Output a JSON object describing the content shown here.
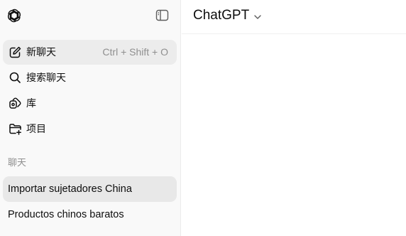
{
  "sidebar": {
    "new_chat": {
      "label": "新聊天",
      "shortcut": "Ctrl + Shift + O"
    },
    "search": {
      "label": "搜索聊天"
    },
    "library": {
      "label": "库"
    },
    "projects": {
      "label": "项目"
    },
    "section_label": "聊天",
    "chats": [
      {
        "title": "Importar sujetadores China",
        "active": true
      },
      {
        "title": "Productos chinos baratos",
        "active": false
      }
    ]
  },
  "header": {
    "model_name": "ChatGPT"
  },
  "icons": {
    "logo": "openai-logo-icon",
    "toggle": "sidebar-toggle-icon",
    "new_chat": "compose-icon",
    "search": "search-icon",
    "library": "library-icon",
    "projects": "folder-plus-icon",
    "chevron": "chevron-down-icon"
  }
}
